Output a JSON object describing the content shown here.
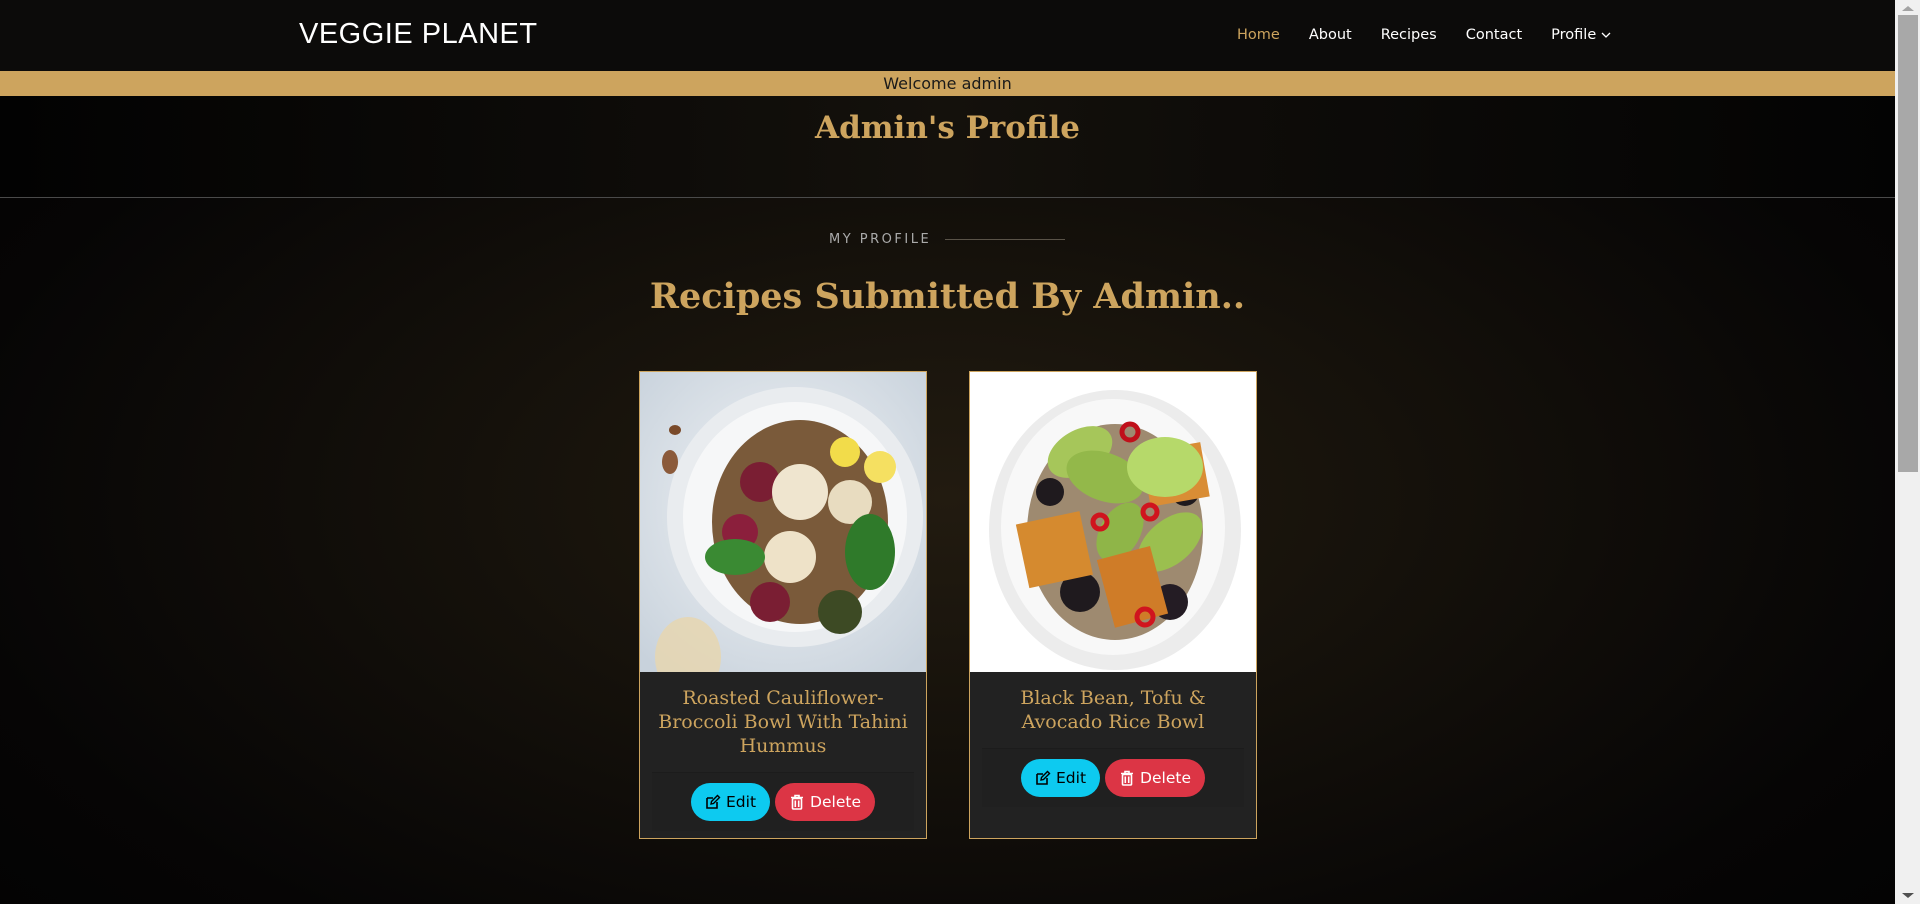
{
  "navbar": {
    "brand": "VEGGIE PLANET",
    "items": [
      {
        "label": "Home",
        "active": true
      },
      {
        "label": "About",
        "active": false
      },
      {
        "label": "Recipes",
        "active": false
      },
      {
        "label": "Contact",
        "active": false
      },
      {
        "label": "Profile",
        "active": false,
        "icon": "chevron-down-icon"
      }
    ]
  },
  "welcome_banner": "Welcome admin",
  "profile_header": {
    "title": "Admin's Profile"
  },
  "section": {
    "tag": "MY PROFILE",
    "title": "Recipes Submitted By Admin.."
  },
  "recipes": [
    {
      "title": "Roasted Cauliflower-Broccoli Bowl With Tahini Hummus",
      "image": "roasted cauliflower broccoli bowl photo",
      "edit_label": "Edit",
      "delete_label": "Delete"
    },
    {
      "title": "Black Bean, Tofu & Avocado Rice Bowl",
      "image": "black bean tofu avocado rice bowl photo",
      "edit_label": "Edit",
      "delete_label": "Delete"
    }
  ],
  "colors": {
    "accent": "#cda45e",
    "edit_button": "#0dcaf0",
    "delete_button": "#dc3545",
    "card_body": "#222222",
    "navbar": "#0c0b0a"
  }
}
